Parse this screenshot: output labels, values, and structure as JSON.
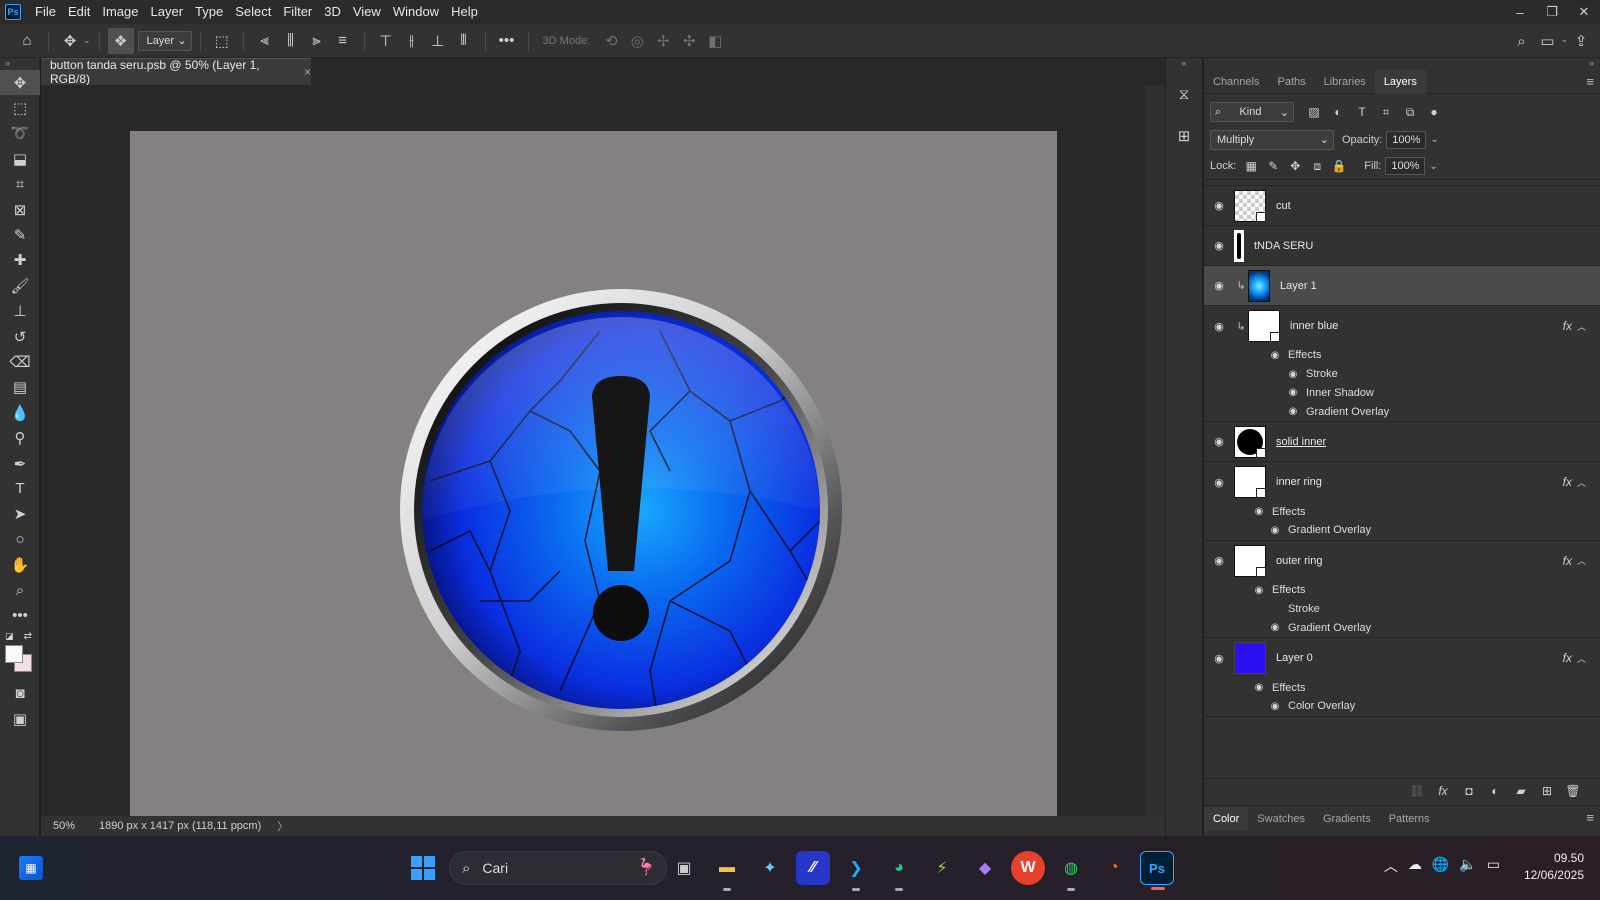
{
  "app": {
    "logo_text": "Ps"
  },
  "menu": [
    "File",
    "Edit",
    "Image",
    "Layer",
    "Type",
    "Select",
    "Filter",
    "3D",
    "View",
    "Window",
    "Help"
  ],
  "window_controls": {
    "minimize": "–",
    "restore": "❐",
    "close": "✕"
  },
  "options_bar": {
    "layer_select": "Layer",
    "mode_3d": "3D Mode:",
    "more": "•••"
  },
  "document": {
    "tab_title": "button tanda seru.psb @ 50% (Layer 1, RGB/8)",
    "tab_close": "×",
    "zoom": "50%",
    "dimensions": "1890 px x 1417 px (118,11 ppcm)",
    "status_arrow": "〉",
    "canvas_color": "#868181"
  },
  "panel": {
    "tabs": [
      "Channels",
      "Paths",
      "Libraries",
      "Layers"
    ],
    "active_tab": "Layers",
    "filter_kind": "Kind",
    "blend_mode": "Multiply",
    "opacity_label": "Opacity:",
    "opacity_value": "100%",
    "lock_label": "Lock:",
    "fill_label": "Fill:",
    "fill_value": "100%",
    "layers": [
      {
        "name": "cut",
        "effects": []
      },
      {
        "name": "tNDA SERU",
        "effects": []
      },
      {
        "name": "Layer 1",
        "selected": true,
        "effects": []
      },
      {
        "name": "inner blue",
        "fx": "fx",
        "effects_label": "Effects",
        "effects": [
          "Stroke",
          "Inner Shadow",
          "Gradient Overlay"
        ]
      },
      {
        "name": "solid inner",
        "effects": []
      },
      {
        "name": "inner ring",
        "fx": "fx",
        "effects_label": "Effects",
        "effects": [
          "Gradient Overlay"
        ]
      },
      {
        "name": "outer ring",
        "fx": "fx",
        "effects_label": "Effects",
        "effects": [
          "Stroke",
          "Gradient Overlay"
        ]
      },
      {
        "name": "Layer 0",
        "fx": "fx",
        "effects_label": "Effects",
        "effects": [
          "Color Overlay"
        ]
      }
    ],
    "bottom_tabs": [
      "Color",
      "Swatches",
      "Gradients",
      "Patterns"
    ],
    "active_bottom_tab": "Color"
  },
  "taskbar": {
    "search_placeholder": "Cari",
    "time": "09.50",
    "date": "12/06/2025"
  },
  "colors": {
    "accent": "#31a8ff",
    "foreground": "#fafafa",
    "background": "#f4dde4",
    "layer0_color": "#2a0ff0"
  }
}
